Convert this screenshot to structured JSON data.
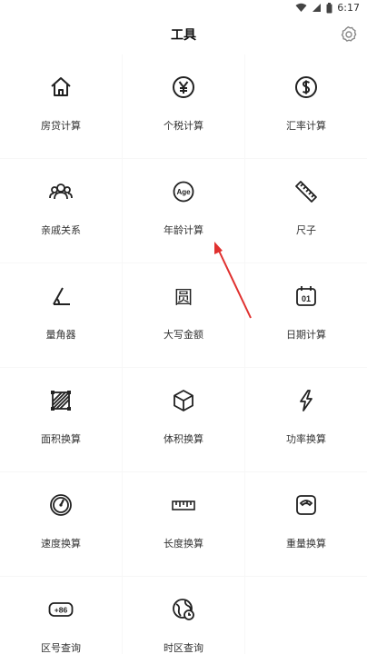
{
  "status_bar": {
    "time": "6:17"
  },
  "header": {
    "title": "工具",
    "settings_icon": "gear-icon"
  },
  "tools": [
    {
      "label": "房贷计算",
      "icon": "house-icon"
    },
    {
      "label": "个税计算",
      "icon": "yen-coin-icon"
    },
    {
      "label": "汇率计算",
      "icon": "dollar-coin-icon"
    },
    {
      "label": "亲戚关系",
      "icon": "people-group-icon"
    },
    {
      "label": "年龄计算",
      "icon": "age-badge-icon"
    },
    {
      "label": "尺子",
      "icon": "ruler-icon"
    },
    {
      "label": "量角器",
      "icon": "protractor-icon"
    },
    {
      "label": "大写金额",
      "icon": "uppercase-yuan-icon"
    },
    {
      "label": "日期计算",
      "icon": "calendar-icon"
    },
    {
      "label": "面积换算",
      "icon": "area-icon"
    },
    {
      "label": "体积换算",
      "icon": "cube-icon"
    },
    {
      "label": "功率换算",
      "icon": "lightning-icon"
    },
    {
      "label": "速度换算",
      "icon": "speedometer-icon"
    },
    {
      "label": "长度换算",
      "icon": "length-ruler-icon"
    },
    {
      "label": "重量换算",
      "icon": "scale-icon"
    },
    {
      "label": "区号查询",
      "icon": "area-code-icon"
    },
    {
      "label": "时区查询",
      "icon": "globe-clock-icon"
    }
  ],
  "icon_glyphs": {
    "calendar_day": "01",
    "area_code": "+86",
    "age_badge": "Age",
    "uppercase_yuan": "圆"
  },
  "colors": {
    "annotation_arrow": "#e0312f",
    "accent_text": "#222222"
  }
}
